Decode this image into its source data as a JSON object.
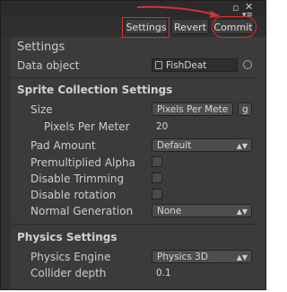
{
  "header_buttons": {
    "settings": "Settings",
    "revert": "Revert",
    "commit": "Commit"
  },
  "title": "Settings",
  "data_object": {
    "label": "Data object",
    "value": "FishDeat"
  },
  "sections": {
    "sprite": "Sprite Collection Settings",
    "physics": "Physics Settings"
  },
  "sprite": {
    "size_label": "Size",
    "size_value": "Pixels Per Mete",
    "size_extra": "g",
    "ppm_label": "Pixels Per Meter",
    "ppm_value": "20",
    "pad_label": "Pad Amount",
    "pad_value": "Default",
    "premult_label": "Premultiplied Alpha",
    "disable_trim_label": "Disable Trimming",
    "disable_rot_label": "Disable rotation",
    "normal_label": "Normal Generation",
    "normal_value": "None"
  },
  "physics": {
    "engine_label": "Physics Engine",
    "engine_value": "Physics 3D",
    "depth_label": "Collider depth",
    "depth_value": "0.1"
  },
  "colors": {
    "highlight": "#d93030",
    "panel": "#3b3b3b"
  }
}
